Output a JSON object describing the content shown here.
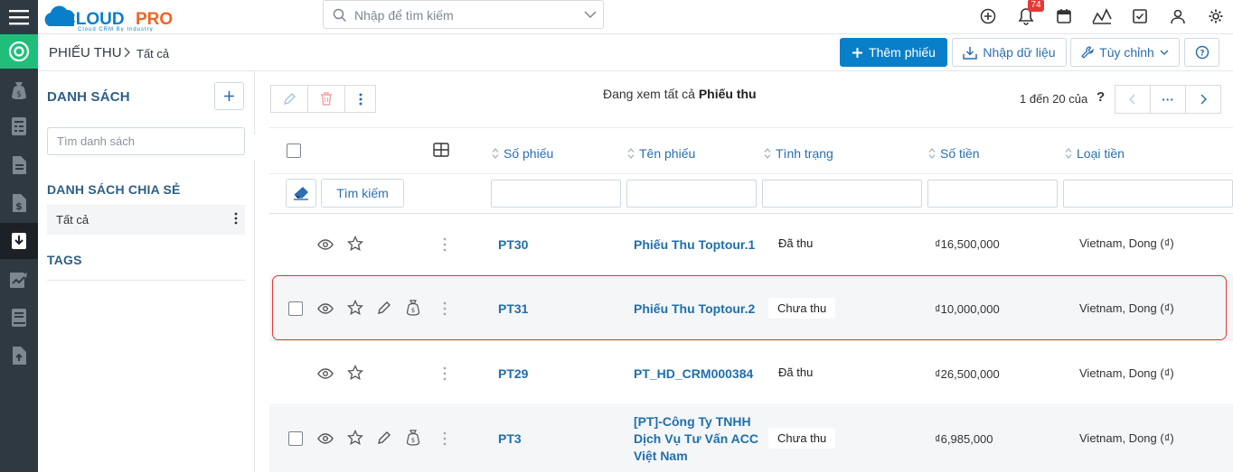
{
  "brand": {
    "name": "CLOUDPRO",
    "tagline": "Cloud CRM By Industry"
  },
  "search": {
    "placeholder": "Nhập để tìm kiếm"
  },
  "header": {
    "notification_count": "74"
  },
  "module": {
    "title": "PHIẾU THU",
    "breadcrumb": "Tất cả"
  },
  "actions": {
    "add": "Thêm phiếu",
    "import": "Nhập dữ liệu",
    "customize": "Tùy chỉnh"
  },
  "sidebar": {
    "list_title": "DANH SÁCH",
    "search_placeholder": "Tìm danh sách",
    "shared_title": "DANH SÁCH CHIA SẺ",
    "shared_item": "Tất cả",
    "tags_title": "TAGS"
  },
  "toolbar": {
    "viewing_prefix": "Đang xem tất cả",
    "viewing_module": "Phiếu thu",
    "pager": "1 đến 20 của",
    "pager_unknown": "?",
    "pager_more": "···"
  },
  "table": {
    "columns": [
      "Số phiếu",
      "Tên phiếu",
      "Tình trạng",
      "Số tiền",
      "Loại tiền"
    ],
    "find_button": "Tìm kiếm",
    "rows": [
      {
        "number": "PT30",
        "name": "Phiếu Thu Toptour.1",
        "status": "Đã thu",
        "amount": "₫16,500,000",
        "currency": "Vietnam, Dong (₫)"
      },
      {
        "number": "PT31",
        "name": "Phiếu Thu Toptour.2",
        "status": "Chưa thu",
        "amount": "₫10,000,000",
        "currency": "Vietnam, Dong (₫)"
      },
      {
        "number": "PT29",
        "name": "PT_HD_CRM000384",
        "status": "Đã thu",
        "amount": "₫26,500,000",
        "currency": "Vietnam, Dong (₫)"
      },
      {
        "number": "PT3",
        "name_lines": [
          "[PT]-Công Ty TNHH",
          "Dịch Vụ Tư Vấn ACC",
          "Việt Nam"
        ],
        "status": "Chưa thu",
        "amount": "₫6,985,000",
        "currency": "Vietnam, Dong (₫)"
      }
    ]
  },
  "colors": {
    "accent": "#0a7fc9",
    "rail": "#2f3942",
    "home": "#1fbf7a",
    "highlight": "#e53935",
    "link": "#1f6fae"
  }
}
